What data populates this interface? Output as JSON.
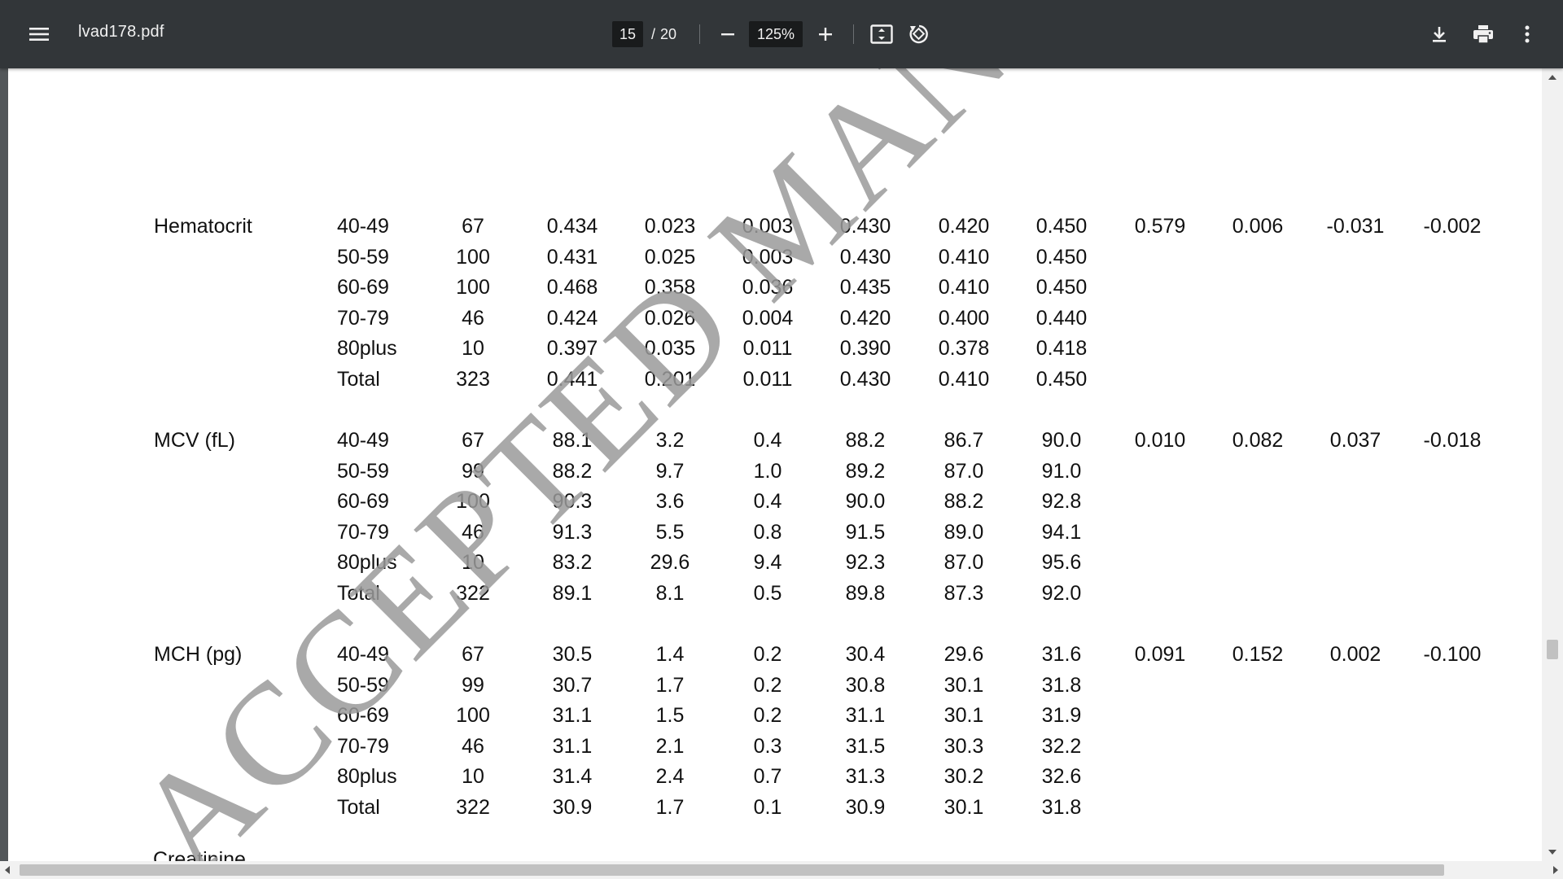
{
  "toolbar": {
    "file_name": "lvad178.pdf",
    "current_page": "15",
    "page_separator": "/",
    "total_pages": "20",
    "zoom_level": "125%",
    "icons": {
      "menu": "menu-icon",
      "zoom_out": "minus-icon",
      "zoom_in": "plus-icon",
      "fit": "fit-to-page-icon",
      "rotate": "rotate-icon",
      "download": "download-icon",
      "print": "print-icon",
      "more": "more-vert-icon"
    }
  },
  "document": {
    "watermark": "ACCEPTED MANUSCRIPT",
    "partial_next_label": "Creatinine",
    "groups": [
      {
        "label": "Hematocrit",
        "rows": [
          [
            "40-49",
            "67",
            "0.434",
            "0.023",
            "0.003",
            "0.430",
            "0.420",
            "0.450",
            "0.579",
            "0.006",
            "-0.031",
            "-0.002"
          ],
          [
            "50-59",
            "100",
            "0.431",
            "0.025",
            "0.003",
            "0.430",
            "0.410",
            "0.450",
            "",
            "",
            "",
            ""
          ],
          [
            "60-69",
            "100",
            "0.468",
            "0.358",
            "0.036",
            "0.435",
            "0.410",
            "0.450",
            "",
            "",
            "",
            ""
          ],
          [
            "70-79",
            "46",
            "0.424",
            "0.026",
            "0.004",
            "0.420",
            "0.400",
            "0.440",
            "",
            "",
            "",
            ""
          ],
          [
            "80plus",
            "10",
            "0.397",
            "0.035",
            "0.011",
            "0.390",
            "0.378",
            "0.418",
            "",
            "",
            "",
            ""
          ],
          [
            "Total",
            "323",
            "0.441",
            "0.201",
            "0.011",
            "0.430",
            "0.410",
            "0.450",
            "",
            "",
            "",
            ""
          ]
        ]
      },
      {
        "label": "MCV (fL)",
        "rows": [
          [
            "40-49",
            "67",
            "88.1",
            "3.2",
            "0.4",
            "88.2",
            "86.7",
            "90.0",
            "0.010",
            "0.082",
            "0.037",
            "-0.018"
          ],
          [
            "50-59",
            "99",
            "88.2",
            "9.7",
            "1.0",
            "89.2",
            "87.0",
            "91.0",
            "",
            "",
            "",
            ""
          ],
          [
            "60-69",
            "100",
            "90.3",
            "3.6",
            "0.4",
            "90.0",
            "88.2",
            "92.8",
            "",
            "",
            "",
            ""
          ],
          [
            "70-79",
            "46",
            "91.3",
            "5.5",
            "0.8",
            "91.5",
            "89.0",
            "94.1",
            "",
            "",
            "",
            ""
          ],
          [
            "80plus",
            "10",
            "83.2",
            "29.6",
            "9.4",
            "92.3",
            "87.0",
            "95.6",
            "",
            "",
            "",
            ""
          ],
          [
            "Total",
            "322",
            "89.1",
            "8.1",
            "0.5",
            "89.8",
            "87.3",
            "92.0",
            "",
            "",
            "",
            ""
          ]
        ]
      },
      {
        "label": "MCH (pg)",
        "rows": [
          [
            "40-49",
            "67",
            "30.5",
            "1.4",
            "0.2",
            "30.4",
            "29.6",
            "31.6",
            "0.091",
            "0.152",
            "0.002",
            "-0.100"
          ],
          [
            "50-59",
            "99",
            "30.7",
            "1.7",
            "0.2",
            "30.8",
            "30.1",
            "31.8",
            "",
            "",
            "",
            ""
          ],
          [
            "60-69",
            "100",
            "31.1",
            "1.5",
            "0.2",
            "31.1",
            "30.1",
            "31.9",
            "",
            "",
            "",
            ""
          ],
          [
            "70-79",
            "46",
            "31.1",
            "2.1",
            "0.3",
            "31.5",
            "30.3",
            "32.2",
            "",
            "",
            "",
            ""
          ],
          [
            "80plus",
            "10",
            "31.4",
            "2.4",
            "0.7",
            "31.3",
            "30.2",
            "32.6",
            "",
            "",
            "",
            ""
          ],
          [
            "Total",
            "322",
            "30.9",
            "1.7",
            "0.1",
            "30.9",
            "30.1",
            "31.8",
            "",
            "",
            "",
            ""
          ]
        ]
      }
    ]
  }
}
